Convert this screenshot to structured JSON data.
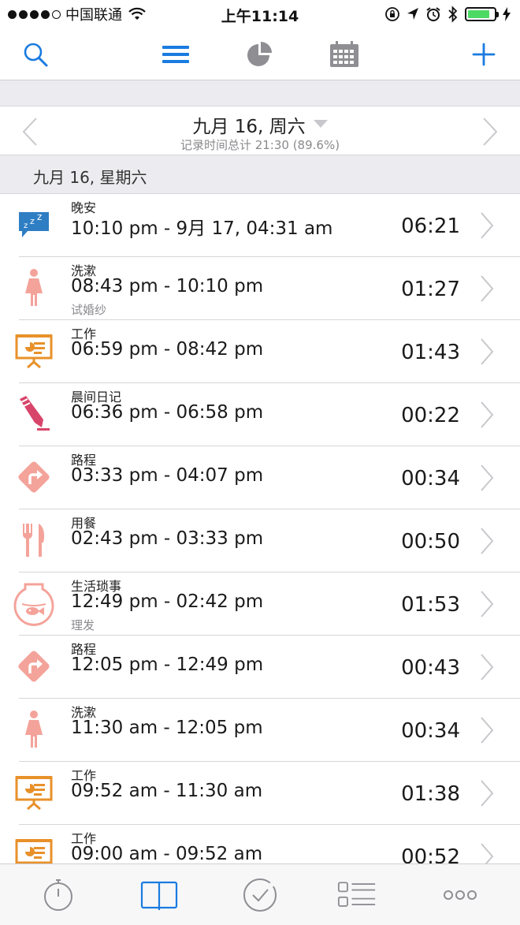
{
  "status_bar": {
    "carrier": "中国联通",
    "time": "上午11:14",
    "battery_level": 0.85
  },
  "toolbar": {
    "icons": [
      "search-icon",
      "list-icon",
      "pie-chart-icon",
      "calendar-icon",
      "plus-icon"
    ]
  },
  "date_nav": {
    "title": "九月 16, 周六",
    "subtitle": "记录时间总计 21:30 (89.6%)"
  },
  "section": {
    "header": "九月 16, 星期六"
  },
  "colors": {
    "accent": "#1a7be0",
    "sleep": "#2f7ec4",
    "pink": "#f4a39a",
    "work": "#e8912a",
    "diary": "#d8456b"
  },
  "entries": [
    {
      "icon": "sleep-bubble-icon",
      "category": "晚安",
      "range": "10:10 pm - 9月 17, 04:31 am",
      "note": "",
      "duration": "06:21"
    },
    {
      "icon": "woman-icon",
      "category": "洗漱",
      "range": "08:43 pm - 10:10 pm",
      "note": "试婚纱",
      "duration": "01:27"
    },
    {
      "icon": "presentation-board-icon",
      "category": "工作",
      "range": "06:59 pm - 08:42 pm",
      "note": "",
      "duration": "01:43"
    },
    {
      "icon": "pencil-icon",
      "category": "晨间日记",
      "range": "06:36 pm - 06:58 pm",
      "note": "",
      "duration": "00:22"
    },
    {
      "icon": "road-sign-icon",
      "category": "路程",
      "range": "03:33 pm - 04:07 pm",
      "note": "",
      "duration": "00:34"
    },
    {
      "icon": "fork-knife-icon",
      "category": "用餐",
      "range": "02:43 pm - 03:33 pm",
      "note": "",
      "duration": "00:50"
    },
    {
      "icon": "fishbowl-icon",
      "category": "生活琐事",
      "range": "12:49 pm - 02:42 pm",
      "note": "理发",
      "duration": "01:53"
    },
    {
      "icon": "road-sign-icon",
      "category": "路程",
      "range": "12:05 pm - 12:49 pm",
      "note": "",
      "duration": "00:43"
    },
    {
      "icon": "woman-icon",
      "category": "洗漱",
      "range": "11:30 am - 12:05 pm",
      "note": "",
      "duration": "00:34"
    },
    {
      "icon": "presentation-board-icon",
      "category": "工作",
      "range": "09:52 am - 11:30 am",
      "note": "",
      "duration": "01:38"
    },
    {
      "icon": "presentation-board-icon",
      "category": "工作",
      "range": "09:00 am - 09:52 am",
      "note": "",
      "duration": "00:52"
    }
  ],
  "tab_bar": {
    "icons": [
      "stopwatch-icon",
      "book-icon",
      "check-circle-icon",
      "checklist-icon",
      "more-icon"
    ],
    "active": 1
  }
}
